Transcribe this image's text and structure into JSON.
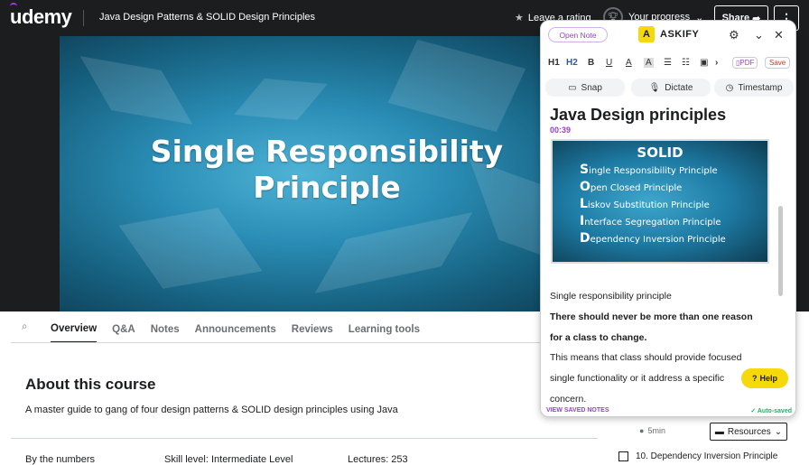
{
  "app": {
    "logo": "udemy"
  },
  "header": {
    "course_title": "Java Design Patterns & SOLID Design Principles",
    "rating_label": "Leave a rating",
    "progress_label": "Your progress",
    "share_label": "Share",
    "more_label": "⋮"
  },
  "video": {
    "title_line1": "Single Responsibility",
    "title_line2": "Principle"
  },
  "tabs": [
    "Overview",
    "Q&A",
    "Notes",
    "Announcements",
    "Reviews",
    "Learning tools"
  ],
  "about": {
    "heading": "About this course",
    "description": "A master guide to gang of four design patterns & SOLID design principles using Java"
  },
  "stats": {
    "by_numbers": "By the numbers",
    "skill_level": "Skill level: Intermediate Level",
    "lectures": "Lectures: 253"
  },
  "sidebar": {
    "duration": "5min",
    "resources_label": "Resources",
    "lecture_item": "10. Dependency Inversion Principle"
  },
  "askify": {
    "open_note": "Open Note",
    "brand": "ASKIFY",
    "toolbar": {
      "h1": "H1",
      "h2": "H2",
      "bold": "B",
      "underline": "U",
      "color": "A",
      "highlight": "A",
      "pdf": "PDF",
      "save": "Save"
    },
    "actions": {
      "snap": "Snap",
      "dictate": "Dictate",
      "timestamp": "Timestamp"
    },
    "note_title": "Java Design principles",
    "timestamp": "00:39",
    "slide": {
      "heading": "SOLID",
      "items": [
        {
          "letter": "S",
          "rest": "ingle Responsibility Principle"
        },
        {
          "letter": "O",
          "rest": "pen Closed Principle"
        },
        {
          "letter": "L",
          "rest": "iskov Substitution Principle"
        },
        {
          "letter": "I",
          "rest": "nterface Segregation Principle"
        },
        {
          "letter": "D",
          "rest": "ependency Inversion Principle"
        }
      ]
    },
    "note_lines": {
      "l1": "Single responsibility principle",
      "l2": "There should never be more than one reason",
      "l3": "for a class to change.",
      "l4": "This means that class should provide focused",
      "l5": "single functionality or it address a specific",
      "l6": "concern."
    },
    "help_label": "Help",
    "view_saved": "VIEW SAVED NOTES",
    "autosaved": "✓ Auto-saved"
  },
  "colors": {
    "brand_purple": "#a435f0",
    "askify_yellow": "#f5d90a",
    "topbar": "#1c1d1f"
  }
}
